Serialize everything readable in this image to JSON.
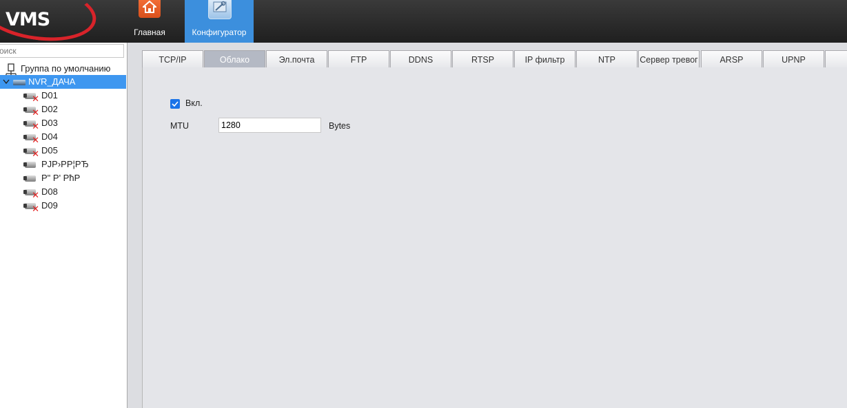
{
  "app": {
    "logo_text": "VMS"
  },
  "nav": {
    "home_label": "Главная",
    "config_label": "Конфигуратор"
  },
  "left": {
    "search_placeholder": "оиск",
    "group_label": "Группа по умолчанию",
    "device_label": "NVR_ДАЧА",
    "cameras": [
      "D01",
      "D02",
      "D03",
      "D04",
      "D05",
      "PJP›PP¦PЂ",
      "P\"  P'  PћP",
      "D08",
      "D09"
    ]
  },
  "tabs": [
    "TCP/IP",
    "Облако",
    "Эл.почта",
    "FTP",
    "DDNS",
    "RTSP",
    "IP фильтр",
    "NTP",
    "Сервер тревог",
    "ARSP",
    "UPNP"
  ],
  "active_tab": "Облако",
  "form": {
    "enable_label": "Вкл.",
    "enabled": true,
    "mtu_label": "MTU",
    "mtu_value": "1280",
    "mtu_unit": "Bytes"
  },
  "colors": {
    "accent": "#3c8fdd",
    "selection": "#3e97f0",
    "checkbox": "#1a73e8",
    "offline_marker": "#e32020"
  }
}
